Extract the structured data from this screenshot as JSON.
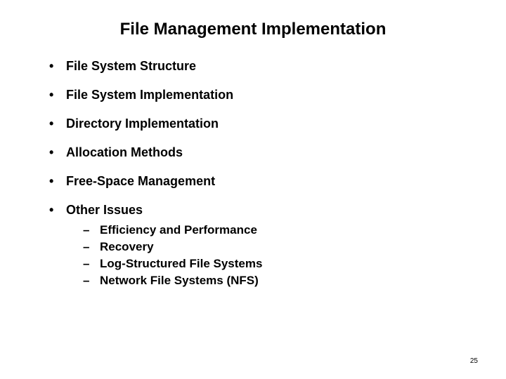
{
  "title": "File Management Implementation",
  "bullets": [
    {
      "text": "File System Structure",
      "subs": []
    },
    {
      "text": "File System Implementation",
      "subs": []
    },
    {
      "text": "Directory Implementation",
      "subs": []
    },
    {
      "text": "Allocation Methods",
      "subs": []
    },
    {
      "text": "Free-Space Management",
      "subs": []
    },
    {
      "text": "Other Issues",
      "subs": [
        "Efficiency and Performance",
        "Recovery",
        "Log-Structured File Systems",
        "Network File Systems (NFS)"
      ]
    }
  ],
  "page_number": "25"
}
